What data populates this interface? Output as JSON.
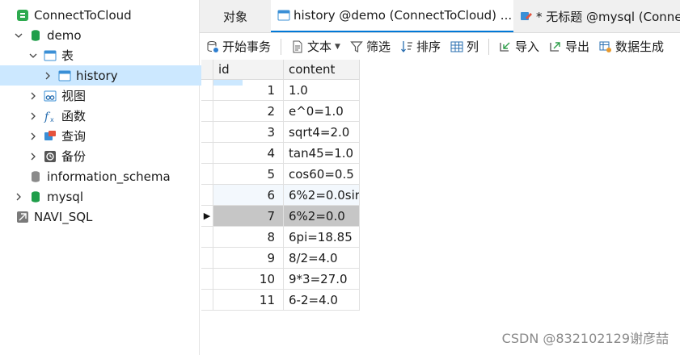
{
  "tree": {
    "connection": "ConnectToCloud",
    "db_demo": "demo",
    "tables_folder": "表",
    "table_history": "history",
    "views": "视图",
    "functions": "函数",
    "queries": "查询",
    "backups": "备份",
    "db_information_schema": "information_schema",
    "db_mysql": "mysql",
    "connection2": "NAVI_SQL"
  },
  "tabs": [
    {
      "label": "对象"
    },
    {
      "label": "history @demo (ConnectToCloud) ..."
    },
    {
      "label": "* 无标题 @mysql (Connec"
    }
  ],
  "toolbar": {
    "begin_transaction": "开始事务",
    "text": "文本",
    "filter": "筛选",
    "sort": "排序",
    "columns": "列",
    "import": "导入",
    "export": "导出",
    "data_generation": "数据生成"
  },
  "grid": {
    "columns": [
      "id",
      "content"
    ],
    "rows": [
      {
        "id": "1",
        "content": "1.0"
      },
      {
        "id": "2",
        "content": "e^0=1.0"
      },
      {
        "id": "3",
        "content": "sqrt4=2.0"
      },
      {
        "id": "4",
        "content": "tan45=1.0"
      },
      {
        "id": "5",
        "content": "cos60=0.5"
      },
      {
        "id": "6",
        "content": "6%2=0.0sir"
      },
      {
        "id": "7",
        "content": "6%2=0.0"
      },
      {
        "id": "8",
        "content": "6pi=18.85"
      },
      {
        "id": "9",
        "content": "8/2=4.0"
      },
      {
        "id": "10",
        "content": "9*3=27.0"
      },
      {
        "id": "11",
        "content": "6-2=4.0"
      }
    ],
    "current_row_marker": "▶"
  },
  "watermark": "CSDN @832102129谢彦喆",
  "colors": {
    "accent": "#0078d7",
    "db_green": "#1f9e4a",
    "selection": "#cce8ff",
    "current_row": "#c6c6c6"
  }
}
